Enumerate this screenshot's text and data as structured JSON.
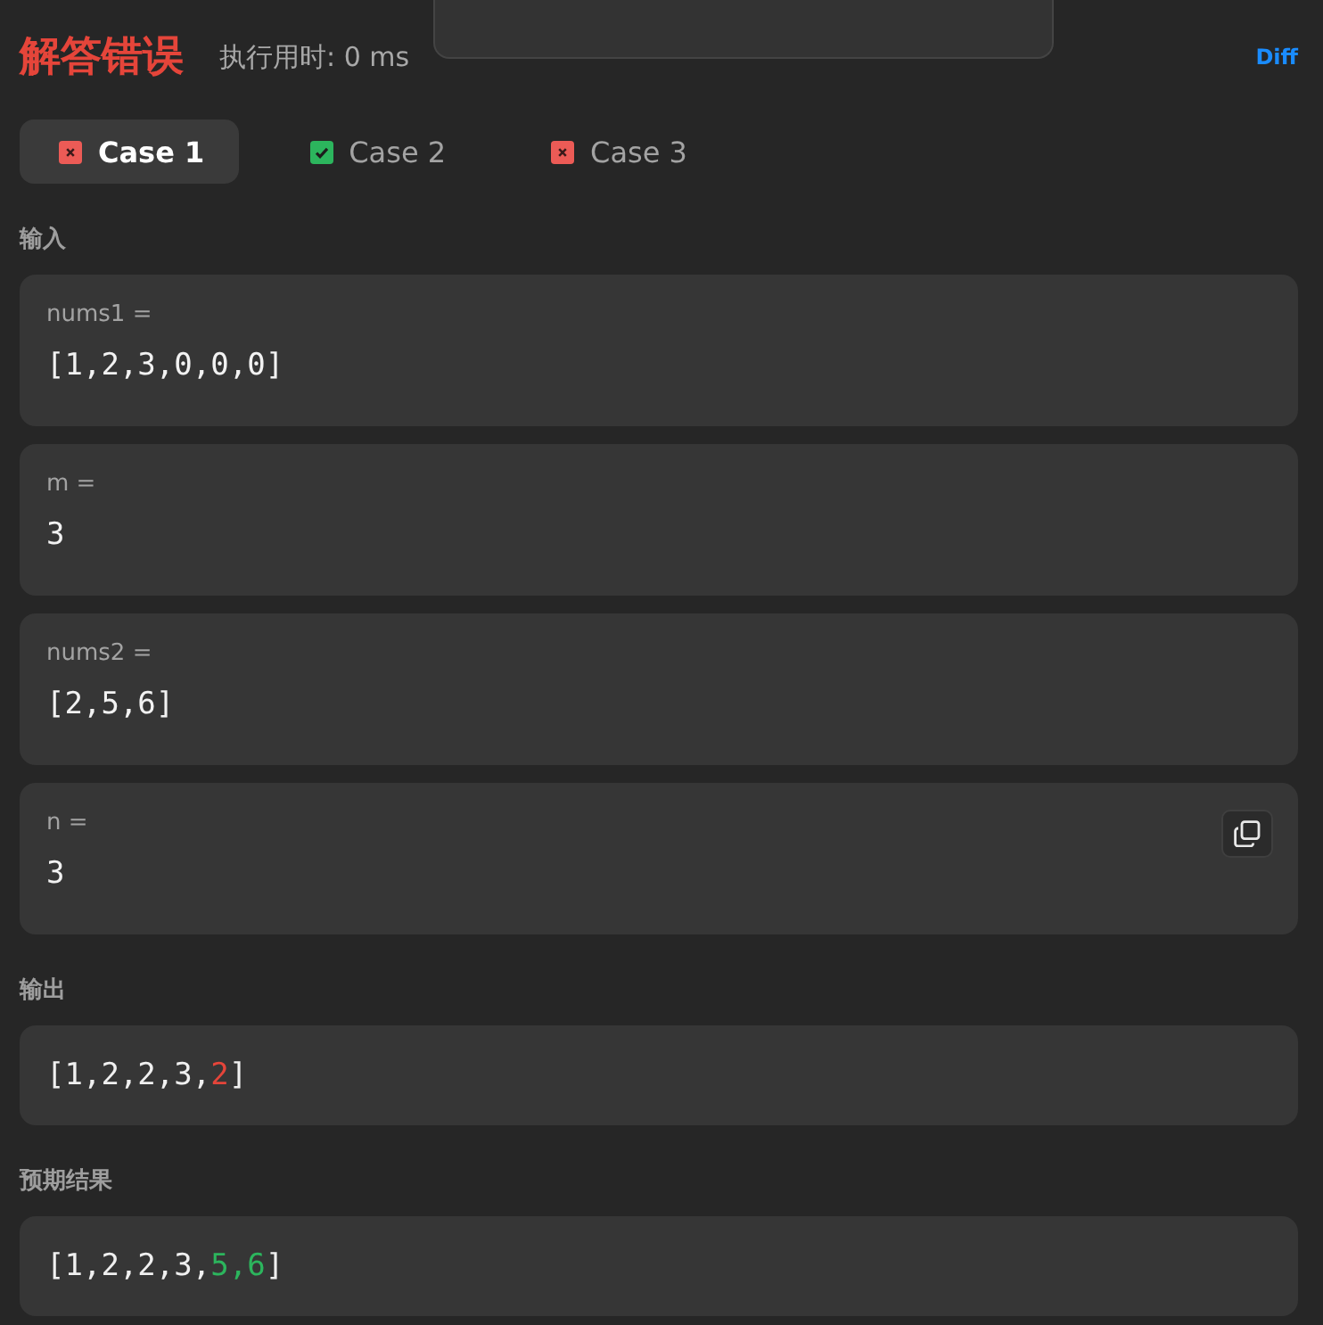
{
  "header": {
    "status": "解答错误",
    "runtime": "执行用时: 0 ms",
    "diff_link": "Diff"
  },
  "tabs": [
    {
      "label": "Case 1",
      "passed": false,
      "selected": true
    },
    {
      "label": "Case 2",
      "passed": true,
      "selected": false
    },
    {
      "label": "Case 3",
      "passed": false,
      "selected": false
    }
  ],
  "input_title": "输入",
  "inputs": [
    {
      "name": "nums1 =",
      "value": "[1,2,3,0,0,0]"
    },
    {
      "name": "m =",
      "value": "3"
    },
    {
      "name": "nums2 =",
      "value": "[2,5,6]"
    },
    {
      "name": "n =",
      "value": "3"
    }
  ],
  "output_title": "输出",
  "output": [
    {
      "text": "[1,2,2,3,",
      "kind": "same"
    },
    {
      "text": "2",
      "kind": "wrong"
    },
    {
      "text": "]",
      "kind": "same"
    }
  ],
  "expected_title": "预期结果",
  "expected": [
    {
      "text": "[1,2,2,3,",
      "kind": "same"
    },
    {
      "text": "5,6",
      "kind": "missing"
    },
    {
      "text": "]",
      "kind": "same"
    }
  ]
}
